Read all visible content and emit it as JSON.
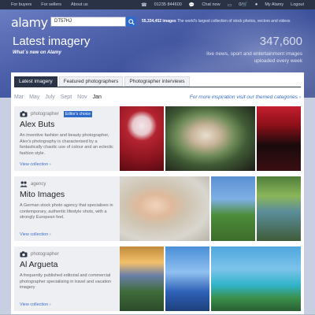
{
  "topnav": {
    "left": [
      "For buyers",
      "For sellers",
      "About us"
    ],
    "phone": "01235 844600",
    "chat": "Chat now",
    "cart_count": "0",
    "my_alamy": "My Alamy",
    "logout": "Logout"
  },
  "header": {
    "logo": "alamy",
    "search_value": "DT57HJ",
    "tagline_count": "55,334,452 images",
    "tagline_rest": " The world's largest collection of stock photos, vectors and videos"
  },
  "hero": {
    "title": "Latest imagery",
    "subtitle": "What`s new on Alamy",
    "count": "347,600",
    "right_line1": "live news, sport and entertainment images",
    "right_line2": "uploaded every week"
  },
  "tabs": [
    "Latest imagery",
    "Featured photographers",
    "Photographer interviews"
  ],
  "months": [
    "Mar",
    "May",
    "July",
    "Sept",
    "Nov",
    "Jan"
  ],
  "current_month": "Jan",
  "more_link": "For more inspiration visit our themed categories ›",
  "contributors": [
    {
      "type": "photographer",
      "badge": "Editor's choice",
      "name": "Alex Buts",
      "desc": "An inventive fashion and beauty photographer, Alex's photography is characterised by a fantastically chaotic use of colour and an eclectic fashion style.",
      "view": "View collection ›"
    },
    {
      "type": "agency",
      "badge": "",
      "name": "Mito Images",
      "desc": "A German stock photo agency that specialises in contemporary, authentic lifestyle shots, with a strongly European feel.",
      "view": "View collection ›"
    },
    {
      "type": "photographer",
      "badge": "",
      "name": "Al Argueta",
      "desc": "A frequently published editorial and commercial photographer specialising in travel and vacation imagery",
      "view": "View collection ›"
    }
  ],
  "colors": {
    "accent": "#2d6ac9",
    "link": "#3a6ccb",
    "dark": "#2b3447"
  }
}
